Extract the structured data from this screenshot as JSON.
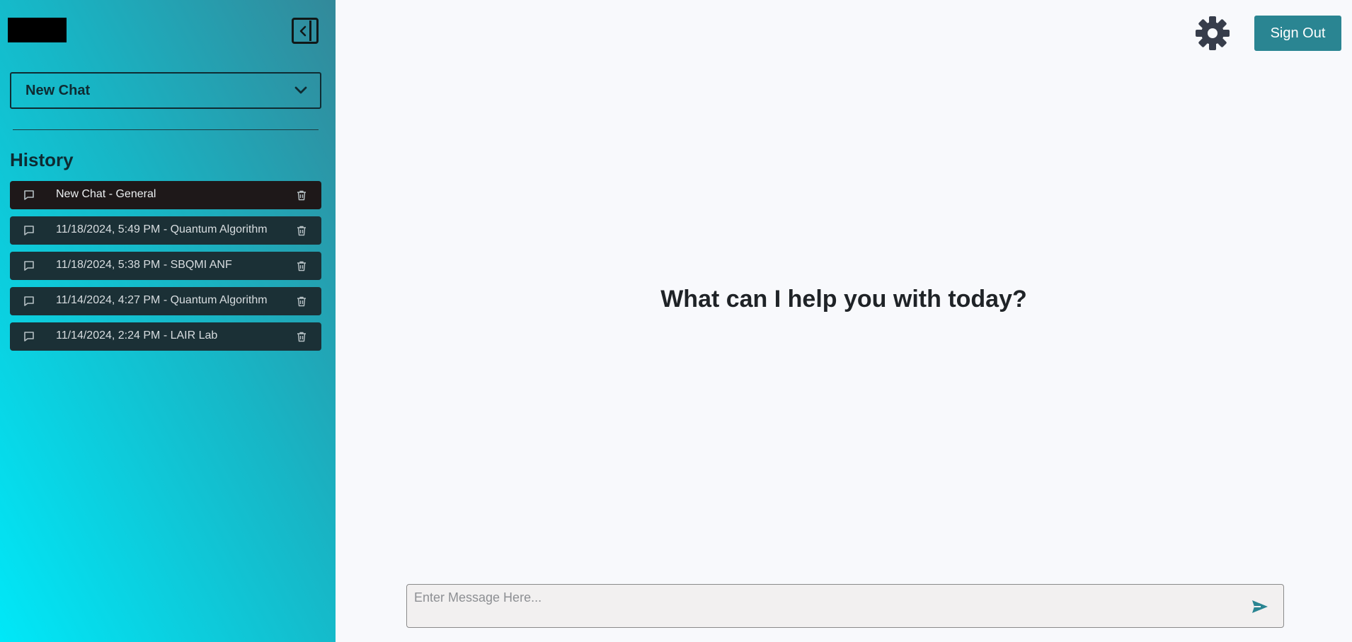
{
  "sidebar": {
    "select_label": "New Chat",
    "history_title": "History",
    "items": [
      {
        "label": "New Chat - General"
      },
      {
        "label": "11/18/2024, 5:49 PM - Quantum Algorithm"
      },
      {
        "label": "11/18/2024, 5:38 PM - SBQMI ANF"
      },
      {
        "label": "11/14/2024, 4:27 PM - Quantum Algorithm"
      },
      {
        "label": "11/14/2024, 2:24 PM - LAIR Lab"
      }
    ]
  },
  "header": {
    "sign_out_label": "Sign Out",
    "settings_icon": "gear-icon"
  },
  "main": {
    "heading": "What can I help you with today?"
  },
  "composer": {
    "placeholder": "Enter Message Here...",
    "send_icon": "send-icon"
  },
  "colors": {
    "accent": "#2a8592",
    "sidebar_gradient_start": "#00e8f8",
    "sidebar_gradient_end": "#33899a",
    "history_item_bg": "#1b3036",
    "history_item_active_bg": "#1e1819"
  }
}
